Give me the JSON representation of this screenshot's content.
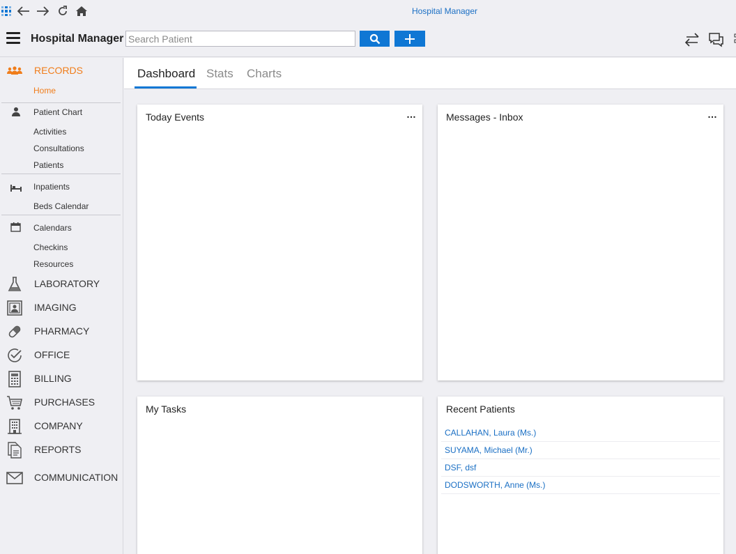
{
  "window": {
    "title": "Hospital Manager"
  },
  "toolbar": {
    "app_name": "Hospital Manager",
    "search_placeholder": "Search Patient",
    "search_value": ""
  },
  "sidebar": {
    "records": {
      "label": "RECORDS",
      "items": [
        {
          "label": "Home",
          "active": true
        },
        {
          "label": "Patient Chart",
          "icon": "person-icon"
        },
        {
          "label": "Activities"
        },
        {
          "label": "Consultations"
        },
        {
          "label": "Patients"
        },
        {
          "label": "Inpatients",
          "icon": "bed-icon"
        },
        {
          "label": "Beds Calendar"
        },
        {
          "label": "Calendars",
          "icon": "calendar-icon"
        },
        {
          "label": "Checkins"
        },
        {
          "label": "Resources"
        }
      ]
    },
    "sections": [
      {
        "label": "LABORATORY",
        "icon": "flask-icon"
      },
      {
        "label": "IMAGING",
        "icon": "imaging-icon"
      },
      {
        "label": "PHARMACY",
        "icon": "pill-icon"
      },
      {
        "label": "OFFICE",
        "icon": "check-circle-icon"
      },
      {
        "label": "BILLING",
        "icon": "calculator-icon"
      },
      {
        "label": "PURCHASES",
        "icon": "cart-icon"
      },
      {
        "label": "COMPANY",
        "icon": "building-icon"
      },
      {
        "label": "REPORTS",
        "icon": "document-icon"
      },
      {
        "label": "COMMUNICATION",
        "icon": "envelope-icon"
      }
    ]
  },
  "main": {
    "tabs": [
      {
        "label": "Dashboard",
        "active": true
      },
      {
        "label": "Stats"
      },
      {
        "label": "Charts"
      }
    ],
    "panels": {
      "today_events": {
        "title": "Today Events",
        "menu": "…"
      },
      "messages": {
        "title": "Messages - Inbox",
        "menu": "…"
      },
      "tasks": {
        "title": "My Tasks"
      },
      "recent": {
        "title": "Recent Patients",
        "items": [
          "CALLAHAN, Laura (Ms.)",
          "SUYAMA, Michael (Mr.)",
          "DSF, dsf",
          "DODSWORTH, Anne (Ms.)"
        ]
      }
    }
  },
  "colors": {
    "accent": "#0f77d4",
    "active": "#f07d1a",
    "link": "#1a6fc4"
  }
}
